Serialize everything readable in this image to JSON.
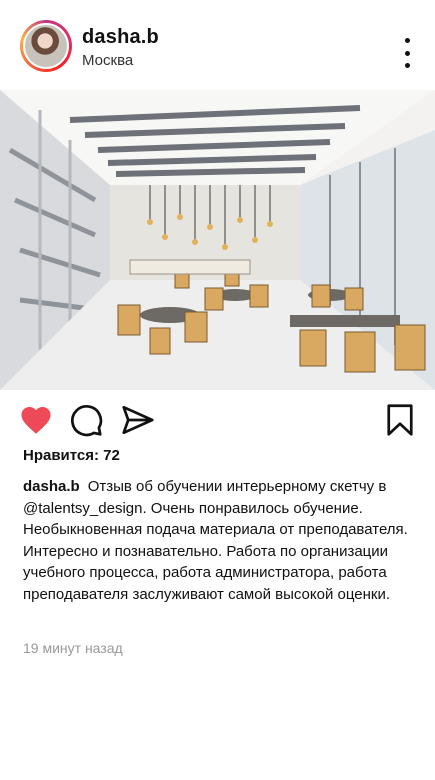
{
  "post": {
    "username": "dasha.b",
    "location": "Москва",
    "likes_text": "Нравится: 72",
    "caption_user": "dasha.b",
    "caption_text": "Отзыв об обучении интерьерному скетчу в @talentsy_design. Очень понравилось обучение. Необыкновенная подача материала от преподавателя. Интересно и познавательно. Работа по организации учебного процесса, работа администратора, работа преподавателя заслуживают самой высокой оценки.",
    "time_ago": "19 минут назад",
    "liked": true
  },
  "icons": {
    "more": "more-vertical-icon",
    "like": "heart-icon",
    "comment": "comment-icon",
    "share": "send-icon",
    "save": "bookmark-icon"
  },
  "colors": {
    "like_red": "#ed4956",
    "text": "#111111",
    "muted": "#999999"
  }
}
